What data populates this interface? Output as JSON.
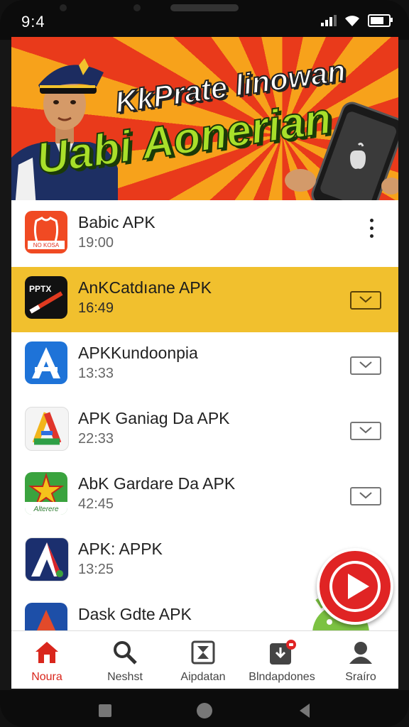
{
  "status_bar": {
    "time": "9:4"
  },
  "banner": {
    "line1": "KkPrate linowan",
    "line2": "Uabi Aonerian"
  },
  "apps": [
    {
      "name": "Babic APK",
      "time": "19:00",
      "icon_text": "NO KOSA",
      "control": "more-options"
    },
    {
      "name": "AnKCatdıane APK",
      "time": "16:49",
      "icon_text": "PPTX",
      "control": "expand",
      "selected": true
    },
    {
      "name": "APKKundoonpia",
      "time": "13:33",
      "icon_text": "",
      "control": "expand"
    },
    {
      "name": "APK Ganiag Da APK",
      "time": "22:33",
      "icon_text": "",
      "control": "expand"
    },
    {
      "name": "AbK Gardare Da APK",
      "time": "42:45",
      "icon_text": "Alterere",
      "control": "expand"
    },
    {
      "name": "APK: APPK",
      "time": "13:25",
      "icon_text": "",
      "control": "none"
    },
    {
      "name": "Dask Gdte APK",
      "time": "",
      "icon_text": "",
      "control": "none"
    }
  ],
  "bottom_nav": [
    {
      "label": "Noura",
      "icon": "home-icon",
      "active": true
    },
    {
      "label": "Neshst",
      "icon": "search-icon"
    },
    {
      "label": "Aipdatan",
      "icon": "hourglass-icon"
    },
    {
      "label": "Blndapdones",
      "icon": "download-icon"
    },
    {
      "label": "Sraíro",
      "icon": "profile-icon"
    }
  ],
  "colors": {
    "accent": "#d9261c",
    "selected_row": "#f1c02e",
    "banner_orange": "#f7a21b",
    "banner_red": "#e93a1b",
    "banner_green": "#a8e02a"
  }
}
